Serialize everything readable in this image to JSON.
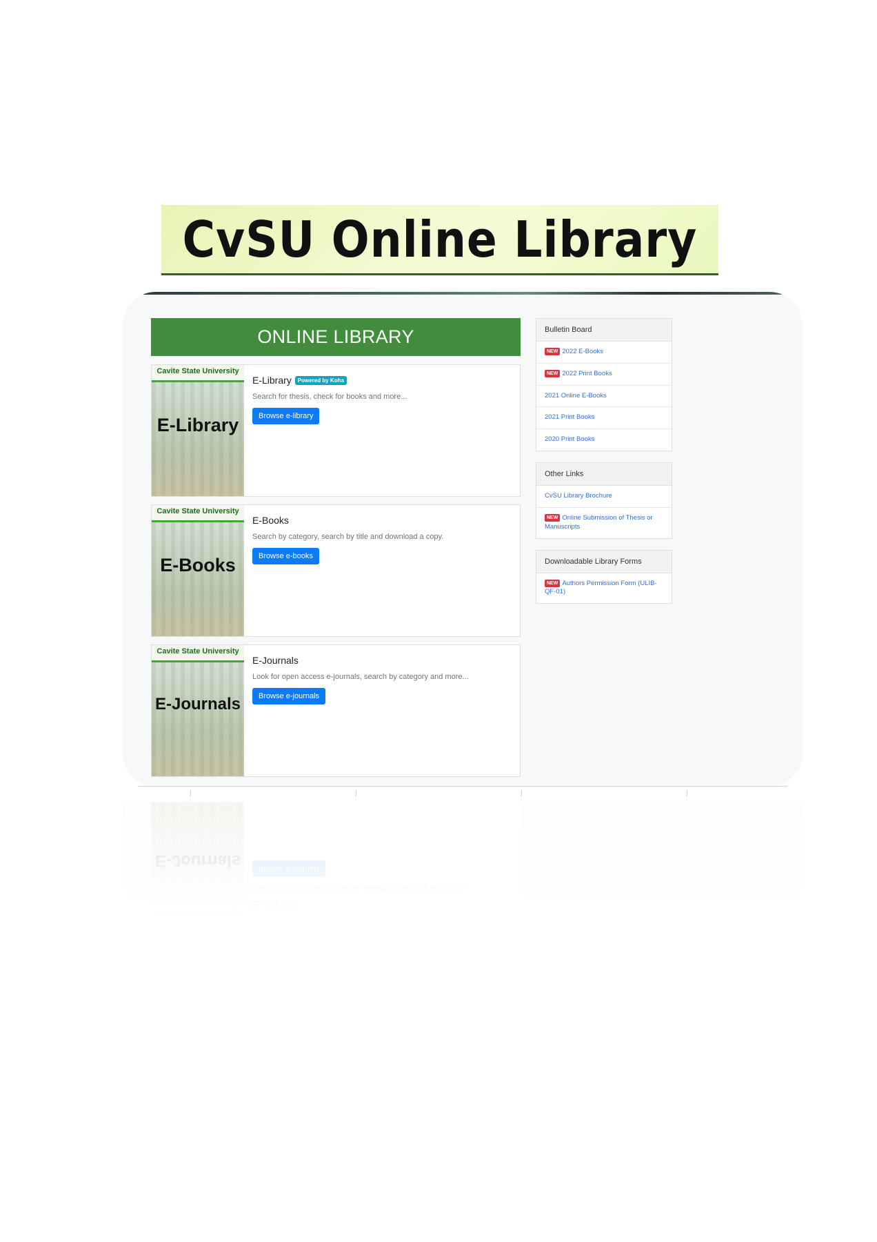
{
  "banner": {
    "title": "CvSU Online Library"
  },
  "main": {
    "header": "ONLINE LIBRARY",
    "resources": [
      {
        "thumb_university": "Cavite State University",
        "thumb_label": "E-Library",
        "title": "E-Library",
        "badge": "Powered by Koha",
        "description": "Search for thesis, check for books and more...",
        "button": "Browse e-library"
      },
      {
        "thumb_university": "Cavite State University",
        "thumb_label": "E-Books",
        "title": "E-Books",
        "description": "Search by category, search by title and download a copy.",
        "button": "Browse e-books"
      },
      {
        "thumb_university": "Cavite State University",
        "thumb_label": "E-Journals",
        "title": "E-Journals",
        "description": "Look for open access e-journals, search by category and more...",
        "button": "Browse e-journals"
      }
    ]
  },
  "sidebar": {
    "new_label": "NEW",
    "bulletin": {
      "title": "Bulletin Board",
      "items": [
        {
          "label": "2022 E-Books",
          "is_new": true
        },
        {
          "label": "2022 Print Books",
          "is_new": true
        },
        {
          "label": "2021 Online E-Books",
          "is_new": false
        },
        {
          "label": "2021 Print Books",
          "is_new": false
        },
        {
          "label": "2020 Print Books",
          "is_new": false
        }
      ]
    },
    "other_links": {
      "title": "Other Links",
      "items": [
        {
          "label": "CvSU Library Brochure",
          "is_new": false
        },
        {
          "label": "Online Submission of Thesis or Manuscripts",
          "is_new": true
        }
      ]
    },
    "forms": {
      "title": "Downloadable Library Forms",
      "items": [
        {
          "label": "Authors Permission Form (ULIB-QF-01)",
          "is_new": true
        }
      ]
    }
  },
  "colors": {
    "header_green": "#428c3e",
    "button_blue": "#0d7bf5",
    "link_blue": "#2f6fd6",
    "new_badge_red": "#d9333f",
    "koha_badge_teal": "#17a2b8"
  }
}
